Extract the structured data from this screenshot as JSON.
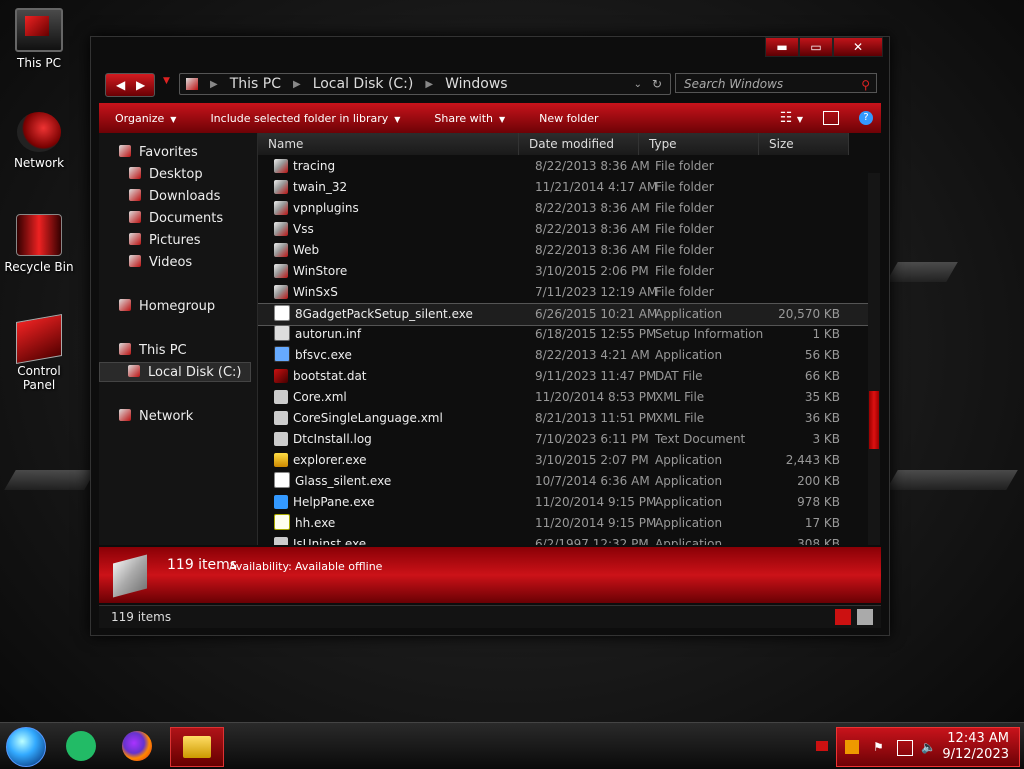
{
  "desktop": {
    "icons": [
      {
        "label": "This PC"
      },
      {
        "label": "Network"
      },
      {
        "label": "Recycle Bin"
      },
      {
        "label": "Control Panel"
      }
    ]
  },
  "window": {
    "caption": {
      "min": "▬",
      "max": "▭",
      "close": "✕"
    },
    "nav": {
      "back": "◀",
      "forward": "▶"
    },
    "breadcrumb": [
      "This PC",
      "Local Disk (C:)",
      "Windows"
    ],
    "search_placeholder": "Search Windows"
  },
  "toolbar": {
    "organize": "Organize",
    "include": "Include selected folder in library",
    "share": "Share with",
    "new_folder": "New folder"
  },
  "navpane": {
    "favorites": "Favorites",
    "desktop": "Desktop",
    "downloads": "Downloads",
    "documents": "Documents",
    "pictures": "Pictures",
    "videos": "Videos",
    "homegroup": "Homegroup",
    "thispc": "This PC",
    "localdisk": "Local Disk (C:)",
    "network": "Network"
  },
  "columns": {
    "name": "Name",
    "date": "Date modified",
    "type": "Type",
    "size": "Size"
  },
  "files": [
    {
      "name": "tracing",
      "date": "8/22/2013 8:36 AM",
      "type": "File folder",
      "size": "",
      "icon": "folder-icon"
    },
    {
      "name": "twain_32",
      "date": "11/21/2014 4:17 AM",
      "type": "File folder",
      "size": "",
      "icon": "folder-icon"
    },
    {
      "name": "vpnplugins",
      "date": "8/22/2013 8:36 AM",
      "type": "File folder",
      "size": "",
      "icon": "folder-icon"
    },
    {
      "name": "Vss",
      "date": "8/22/2013 8:36 AM",
      "type": "File folder",
      "size": "",
      "icon": "folder-icon"
    },
    {
      "name": "Web",
      "date": "8/22/2013 8:36 AM",
      "type": "File folder",
      "size": "",
      "icon": "folder-icon"
    },
    {
      "name": "WinStore",
      "date": "3/10/2015 2:06 PM",
      "type": "File folder",
      "size": "",
      "icon": "folder-icon"
    },
    {
      "name": "WinSxS",
      "date": "7/11/2023 12:19 AM",
      "type": "File folder",
      "size": "",
      "icon": "folder-icon"
    },
    {
      "name": "8GadgetPackSetup_silent.exe",
      "date": "6/26/2015 10:21 AM",
      "type": "Application",
      "size": "20,570 KB",
      "icon": "app-icon"
    },
    {
      "name": "autorun.inf",
      "date": "6/18/2015 12:55 PM",
      "type": "Setup Information",
      "size": "1 KB",
      "icon": "info-file-icon"
    },
    {
      "name": "bfsvc.exe",
      "date": "8/22/2013 4:21 AM",
      "type": "Application",
      "size": "56 KB",
      "icon": "exe-icon"
    },
    {
      "name": "bootstat.dat",
      "date": "9/11/2023 11:47 PM",
      "type": "DAT File",
      "size": "66 KB",
      "icon": "dat-file-icon"
    },
    {
      "name": "Core.xml",
      "date": "11/20/2014 8:53 PM",
      "type": "XML File",
      "size": "35 KB",
      "icon": "xml-file-icon"
    },
    {
      "name": "CoreSingleLanguage.xml",
      "date": "8/21/2013 11:51 PM",
      "type": "XML File",
      "size": "36 KB",
      "icon": "xml-file-icon"
    },
    {
      "name": "DtcInstall.log",
      "date": "7/10/2023 6:11 PM",
      "type": "Text Document",
      "size": "3 KB",
      "icon": "text-file-icon"
    },
    {
      "name": "explorer.exe",
      "date": "3/10/2015 2:07 PM",
      "type": "Application",
      "size": "2,443 KB",
      "icon": "explorer-icon"
    },
    {
      "name": "Glass_silent.exe",
      "date": "10/7/2014 6:36 AM",
      "type": "Application",
      "size": "200 KB",
      "icon": "app-icon"
    },
    {
      "name": "HelpPane.exe",
      "date": "11/20/2014 9:15 PM",
      "type": "Application",
      "size": "978 KB",
      "icon": "help-icon"
    },
    {
      "name": "hh.exe",
      "date": "11/20/2014 9:15 PM",
      "type": "Application",
      "size": "17 KB",
      "icon": "hh-icon"
    },
    {
      "name": "IsUninst.exe",
      "date": "6/2/1997 12:32 PM",
      "type": "Application",
      "size": "308 KB",
      "icon": "uninstall-icon"
    }
  ],
  "details": {
    "count": "119 items",
    "availability_label": "Availability:",
    "availability_value": "Available offline"
  },
  "status": {
    "count": "119 items"
  },
  "taskbar": {
    "time": "12:43 AM",
    "date": "9/12/2023"
  },
  "colors": {
    "accent": "#c8131b",
    "accent_dark": "#6d0206",
    "background": "#0d0d0d"
  }
}
